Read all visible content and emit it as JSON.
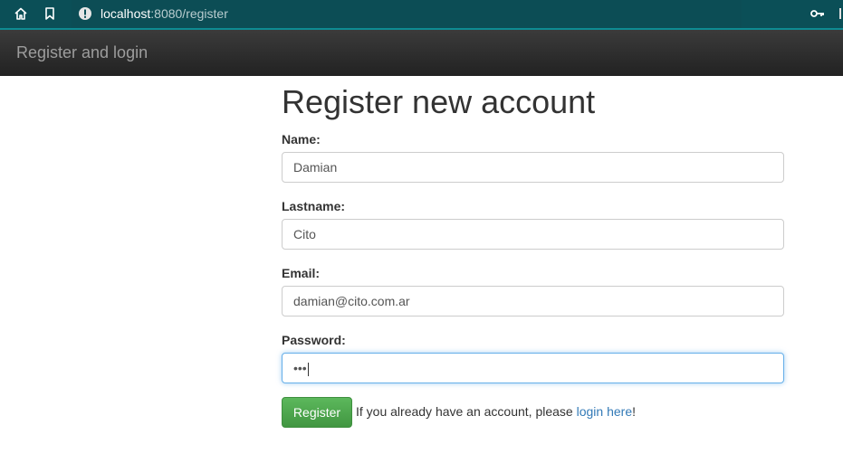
{
  "browser": {
    "url_host": "localhost",
    "url_rest": ":8080/register"
  },
  "navbar": {
    "brand": "Register and login"
  },
  "form": {
    "heading": "Register new account",
    "name_label": "Name:",
    "name_value": "Damian",
    "lastname_label": "Lastname:",
    "lastname_value": "Cito",
    "email_label": "Email:",
    "email_value": "damian@cito.com.ar",
    "password_label": "Password:",
    "password_masked": "•••",
    "register_button": "Register",
    "hint_text": "If you already have an account, please ",
    "login_link": "login here",
    "hint_end": "!"
  },
  "colors": {
    "chrome_bg": "#0b4f57",
    "navbar_bg": "#222222",
    "button_green": "#5cb85c",
    "link_blue": "#337ab7"
  }
}
